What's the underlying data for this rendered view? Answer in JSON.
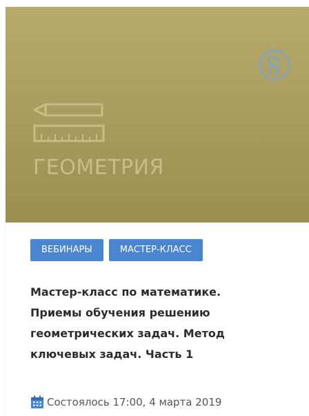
{
  "card": {
    "subject": "ГЕОМЕТРИЯ",
    "tags": [
      "ВЕБИНАРЫ",
      "МАСТЕР-КЛАСС"
    ],
    "title_lines": [
      "Мастер-класс по математике.",
      "Приемы обучения решению",
      "геометрических задач. Метод",
      "ключевых задач. Часть 1"
    ],
    "date": "Состоялось 17:00, 4 марта 2019"
  },
  "icons": {
    "logo": "brand-logo-icon",
    "pencil": "pencil-icon",
    "ruler": "ruler-icon",
    "calendar": "calendar-icon"
  },
  "colors": {
    "banner": "#a89a5c",
    "banner_icons": "#c9bd86",
    "logo": "#7ea4cc",
    "tag": "#4a86cf",
    "title": "#2c2c2c"
  }
}
